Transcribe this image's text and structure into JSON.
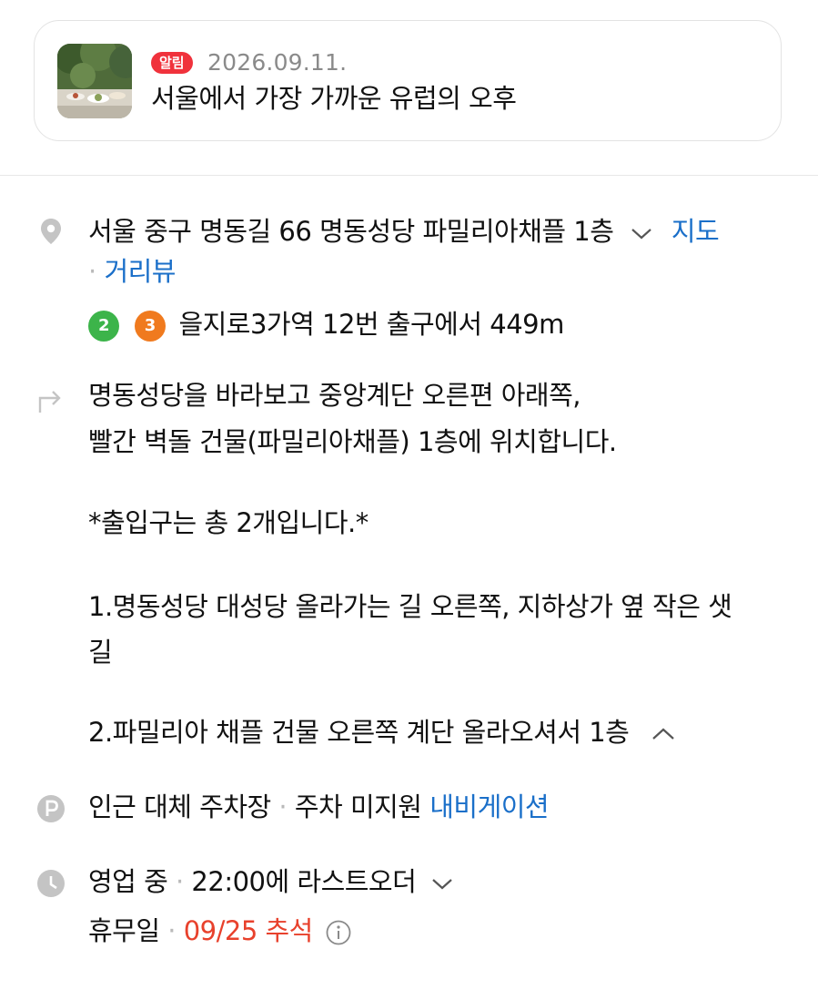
{
  "notice": {
    "badge": "알림",
    "date": "2026.09.11.",
    "title": "서울에서 가장 가까운 유럽의 오후"
  },
  "address": {
    "text": "서울 중구 명동길 66 명동성당 파밀리아채플 1층",
    "map_link": "지도",
    "separator": "·",
    "street_view_link": "거리뷰"
  },
  "subway": {
    "lines": [
      {
        "label": "2",
        "color": "#3cb44a"
      },
      {
        "label": "3",
        "color": "#f07a1e"
      }
    ],
    "text": "을지로3가역 12번 출구에서 449m"
  },
  "directions": {
    "line1": "명동성당을 바라보고 중앙계단 오른편 아래쪽,",
    "line2": "빨간 벽돌 건물(파밀리아채플) 1층에 위치합니다.",
    "line3": "*출입구는 총 2개입니다.*",
    "line4": "1.명동성당 대성당 올라가는 길 오른쪽, 지하상가 옆 작은 샛",
    "line5": "길",
    "line6": "2.파밀리아 채플 건물 오른쪽 계단 올라오셔서 1층"
  },
  "parking": {
    "label": "인근 대체 주차장",
    "separator": "·",
    "info": "주차 미지원",
    "nav_link": "내비게이션"
  },
  "hours": {
    "status": "영업 중",
    "separator": "·",
    "last_order": "22:00에 라스트오더",
    "holiday_label": "휴무일",
    "holiday_separator": "·",
    "holiday_value": "09/25 추석"
  },
  "colors": {
    "accent_link": "#1a6fc9",
    "badge": "#f0323c",
    "holiday": "#e8412c",
    "icon_gray": "#c4c4c4"
  },
  "icons": [
    "location-pin-icon",
    "turn-arrow-icon",
    "parking-icon",
    "clock-icon",
    "chevron-down-icon",
    "chevron-up-icon",
    "info-icon"
  ]
}
